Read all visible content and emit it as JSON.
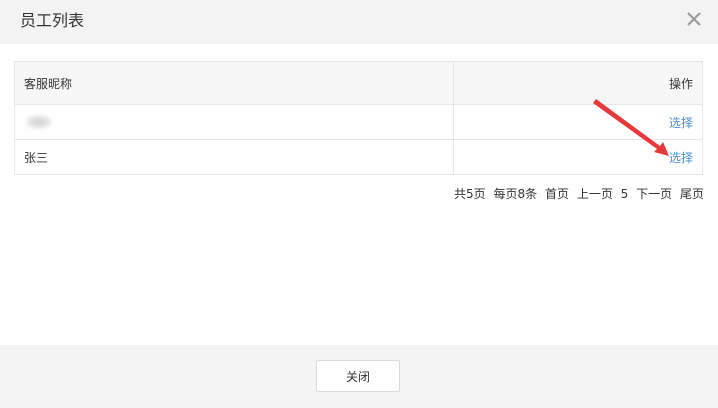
{
  "dialog": {
    "title": "员工列表",
    "close_icon": "close-icon"
  },
  "table": {
    "columns": [
      "客服昵称",
      "操作"
    ],
    "rows": [
      {
        "name": "",
        "action": "选择",
        "name_blurred": true
      },
      {
        "name": "张三",
        "action": "选择",
        "name_blurred": false
      }
    ]
  },
  "pagination": {
    "total": "共5页",
    "per_page": "每页8条",
    "first": "首页",
    "prev": "上一页",
    "current": "5",
    "next": "下一页",
    "last": "尾页"
  },
  "footer": {
    "close_label": "关闭"
  },
  "colors": {
    "link": "#4a90d9",
    "annotation_arrow": "#e8393a",
    "header_bg": "#f3f3f3"
  }
}
